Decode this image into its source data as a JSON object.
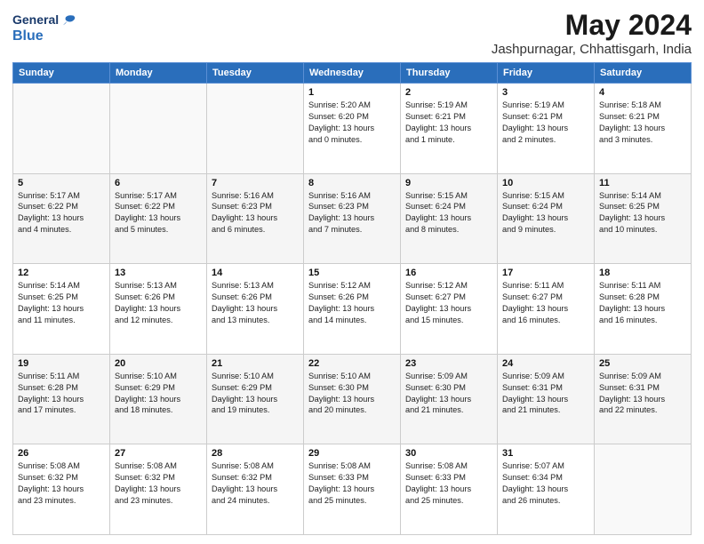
{
  "header": {
    "logo_line1": "General",
    "logo_line2": "Blue",
    "title": "May 2024",
    "subtitle": "Jashpurnagar, Chhattisgarh, India"
  },
  "weekdays": [
    "Sunday",
    "Monday",
    "Tuesday",
    "Wednesday",
    "Thursday",
    "Friday",
    "Saturday"
  ],
  "weeks": [
    [
      {
        "day": "",
        "info": ""
      },
      {
        "day": "",
        "info": ""
      },
      {
        "day": "",
        "info": ""
      },
      {
        "day": "1",
        "info": "Sunrise: 5:20 AM\nSunset: 6:20 PM\nDaylight: 13 hours\nand 0 minutes."
      },
      {
        "day": "2",
        "info": "Sunrise: 5:19 AM\nSunset: 6:21 PM\nDaylight: 13 hours\nand 1 minute."
      },
      {
        "day": "3",
        "info": "Sunrise: 5:19 AM\nSunset: 6:21 PM\nDaylight: 13 hours\nand 2 minutes."
      },
      {
        "day": "4",
        "info": "Sunrise: 5:18 AM\nSunset: 6:21 PM\nDaylight: 13 hours\nand 3 minutes."
      }
    ],
    [
      {
        "day": "5",
        "info": "Sunrise: 5:17 AM\nSunset: 6:22 PM\nDaylight: 13 hours\nand 4 minutes."
      },
      {
        "day": "6",
        "info": "Sunrise: 5:17 AM\nSunset: 6:22 PM\nDaylight: 13 hours\nand 5 minutes."
      },
      {
        "day": "7",
        "info": "Sunrise: 5:16 AM\nSunset: 6:23 PM\nDaylight: 13 hours\nand 6 minutes."
      },
      {
        "day": "8",
        "info": "Sunrise: 5:16 AM\nSunset: 6:23 PM\nDaylight: 13 hours\nand 7 minutes."
      },
      {
        "day": "9",
        "info": "Sunrise: 5:15 AM\nSunset: 6:24 PM\nDaylight: 13 hours\nand 8 minutes."
      },
      {
        "day": "10",
        "info": "Sunrise: 5:15 AM\nSunset: 6:24 PM\nDaylight: 13 hours\nand 9 minutes."
      },
      {
        "day": "11",
        "info": "Sunrise: 5:14 AM\nSunset: 6:25 PM\nDaylight: 13 hours\nand 10 minutes."
      }
    ],
    [
      {
        "day": "12",
        "info": "Sunrise: 5:14 AM\nSunset: 6:25 PM\nDaylight: 13 hours\nand 11 minutes."
      },
      {
        "day": "13",
        "info": "Sunrise: 5:13 AM\nSunset: 6:26 PM\nDaylight: 13 hours\nand 12 minutes."
      },
      {
        "day": "14",
        "info": "Sunrise: 5:13 AM\nSunset: 6:26 PM\nDaylight: 13 hours\nand 13 minutes."
      },
      {
        "day": "15",
        "info": "Sunrise: 5:12 AM\nSunset: 6:26 PM\nDaylight: 13 hours\nand 14 minutes."
      },
      {
        "day": "16",
        "info": "Sunrise: 5:12 AM\nSunset: 6:27 PM\nDaylight: 13 hours\nand 15 minutes."
      },
      {
        "day": "17",
        "info": "Sunrise: 5:11 AM\nSunset: 6:27 PM\nDaylight: 13 hours\nand 16 minutes."
      },
      {
        "day": "18",
        "info": "Sunrise: 5:11 AM\nSunset: 6:28 PM\nDaylight: 13 hours\nand 16 minutes."
      }
    ],
    [
      {
        "day": "19",
        "info": "Sunrise: 5:11 AM\nSunset: 6:28 PM\nDaylight: 13 hours\nand 17 minutes."
      },
      {
        "day": "20",
        "info": "Sunrise: 5:10 AM\nSunset: 6:29 PM\nDaylight: 13 hours\nand 18 minutes."
      },
      {
        "day": "21",
        "info": "Sunrise: 5:10 AM\nSunset: 6:29 PM\nDaylight: 13 hours\nand 19 minutes."
      },
      {
        "day": "22",
        "info": "Sunrise: 5:10 AM\nSunset: 6:30 PM\nDaylight: 13 hours\nand 20 minutes."
      },
      {
        "day": "23",
        "info": "Sunrise: 5:09 AM\nSunset: 6:30 PM\nDaylight: 13 hours\nand 21 minutes."
      },
      {
        "day": "24",
        "info": "Sunrise: 5:09 AM\nSunset: 6:31 PM\nDaylight: 13 hours\nand 21 minutes."
      },
      {
        "day": "25",
        "info": "Sunrise: 5:09 AM\nSunset: 6:31 PM\nDaylight: 13 hours\nand 22 minutes."
      }
    ],
    [
      {
        "day": "26",
        "info": "Sunrise: 5:08 AM\nSunset: 6:32 PM\nDaylight: 13 hours\nand 23 minutes."
      },
      {
        "day": "27",
        "info": "Sunrise: 5:08 AM\nSunset: 6:32 PM\nDaylight: 13 hours\nand 23 minutes."
      },
      {
        "day": "28",
        "info": "Sunrise: 5:08 AM\nSunset: 6:32 PM\nDaylight: 13 hours\nand 24 minutes."
      },
      {
        "day": "29",
        "info": "Sunrise: 5:08 AM\nSunset: 6:33 PM\nDaylight: 13 hours\nand 25 minutes."
      },
      {
        "day": "30",
        "info": "Sunrise: 5:08 AM\nSunset: 6:33 PM\nDaylight: 13 hours\nand 25 minutes."
      },
      {
        "day": "31",
        "info": "Sunrise: 5:07 AM\nSunset: 6:34 PM\nDaylight: 13 hours\nand 26 minutes."
      },
      {
        "day": "",
        "info": ""
      }
    ]
  ]
}
